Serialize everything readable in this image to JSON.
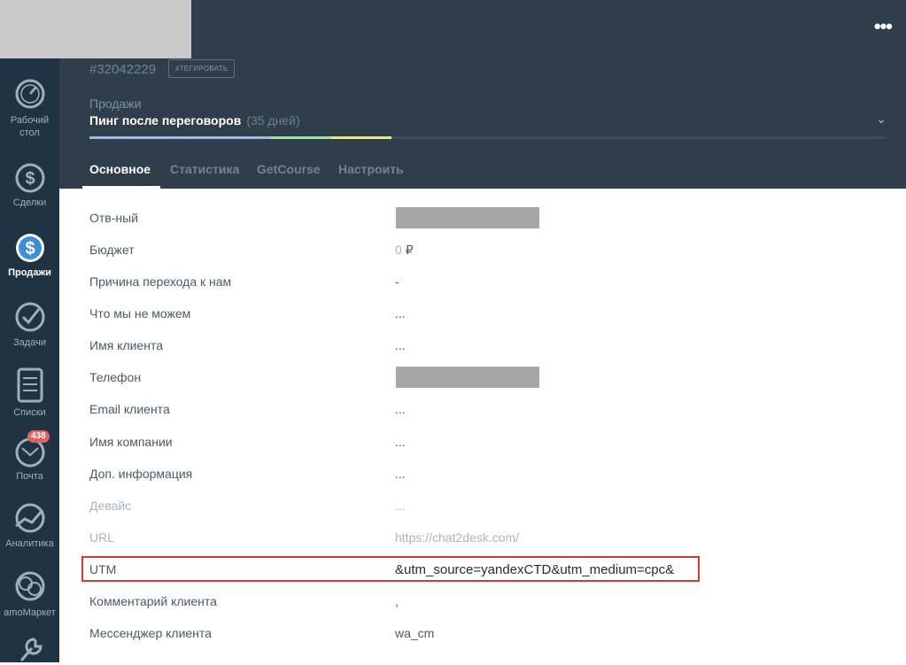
{
  "sidebar": {
    "items": [
      {
        "label": "Рабочий\nстол",
        "icon": "dashboard-icon"
      },
      {
        "label": "Сделки",
        "icon": "dollar-icon"
      },
      {
        "label": "Продажи",
        "icon": "sales-icon"
      },
      {
        "label": "Задачи",
        "icon": "check-icon"
      },
      {
        "label": "Списки",
        "icon": "list-icon"
      },
      {
        "label": "Почта",
        "icon": "mail-icon",
        "badge": "438"
      },
      {
        "label": "Аналитика",
        "icon": "analytics-icon"
      },
      {
        "label": "amoМаркет",
        "icon": "market-icon"
      },
      {
        "label": "",
        "icon": "settings-icon"
      }
    ]
  },
  "header": {
    "lead_id": "#32042229",
    "tag_button": "#ТЕГИРОВАТЬ",
    "pipeline": "Продажи",
    "stage": "Пинг после переговоров",
    "stage_days": "(35 дней)",
    "more": "•••",
    "chevron": "⌄"
  },
  "tabs": [
    "Основное",
    "Статистика",
    "GetCourse",
    "Настроить"
  ],
  "fields": [
    {
      "label": "Отв-ный",
      "value": ""
    },
    {
      "label": "Бюджет",
      "value": "0",
      "currency": "₽"
    },
    {
      "label": "Причина перехода к нам",
      "value": "-"
    },
    {
      "label": "Что мы не можем",
      "value": "..."
    },
    {
      "label": "Имя клиента",
      "value": "..."
    },
    {
      "label": "Телефон",
      "value": ""
    },
    {
      "label": "Email клиента",
      "value": "..."
    },
    {
      "label": "Имя компании",
      "value": "..."
    },
    {
      "label": "Доп. информация",
      "value": "..."
    },
    {
      "label": "Девайс",
      "value": "..."
    },
    {
      "label": "URL",
      "value": "https://chat2desk.com/"
    },
    {
      "label": "UTM",
      "value": "&utm_source=yandexCTD&utm_medium=cpc&"
    },
    {
      "label": "Комментарий клиента",
      "value": ","
    },
    {
      "label": "Мессенджер клиента",
      "value": "wa_cm"
    }
  ],
  "colors": {
    "sidebar_bg": "#1f3344",
    "header_bg": "#2f3e4a",
    "highlight": "#d7392d",
    "badge": "#e85f5f"
  }
}
